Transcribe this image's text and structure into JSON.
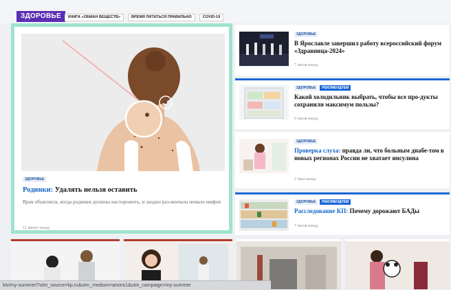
{
  "header": {
    "logo": "ЗДОРОВЬЕ",
    "tags": [
      "КНИГА «ОБМАН ВЕЩЕСТВ»",
      "ВРЕМЯ ПИТАТЬСЯ ПРАВИЛЬНО",
      "COVID-19"
    ]
  },
  "featured": {
    "badge": "ЗДОРОВЬЕ",
    "title_highlight": "Родинки:",
    "title_rest": " Удалять нельзя оставить",
    "description": "Врач объяснила, когда родинки должны насторожить, и заодно раз-венчала немало мифов",
    "time": "12 минут назад"
  },
  "news": [
    {
      "badges": [
        "ЗДОРОВЬЕ"
      ],
      "title_highlight": "",
      "title_rest": "В Ярославле завершил работу всероссийский форум «Здравница-2024»",
      "time": "7 часов назад"
    },
    {
      "badges": [
        "ЗДОРОВЬЕ",
        "РЕКОМЕНДУЕМ"
      ],
      "title_highlight": "",
      "title_rest": "Какой холодильник выбрать, чтобы все про-дукты сохранили максимум пользы?",
      "time": "6 часов назад"
    },
    {
      "badges": [
        "ЗДОРОВЬЕ"
      ],
      "title_highlight": "Проверка слуха:",
      "title_rest": " правда ли, что больным диабе-том в новых регионах России не хватает инсулина",
      "time": "2 часа назад"
    },
    {
      "badges": [
        "ЗДОРОВЬЕ",
        "РЕКОМЕНДУЕМ"
      ],
      "title_highlight": "Расследование КП:",
      "title_rest": " Почему дорожают БАДы",
      "time": "7 часов назад"
    }
  ],
  "status_url": "ktv/my-summer/?utm_source=kp.ru&utm_medium=anons1&utm_campaign=my-summer",
  "colors": {
    "accent": "#1464c8",
    "brand": "#5a2fb3",
    "featured_border": "#9fe3cf",
    "bottom_bar": "#b33b2e"
  }
}
